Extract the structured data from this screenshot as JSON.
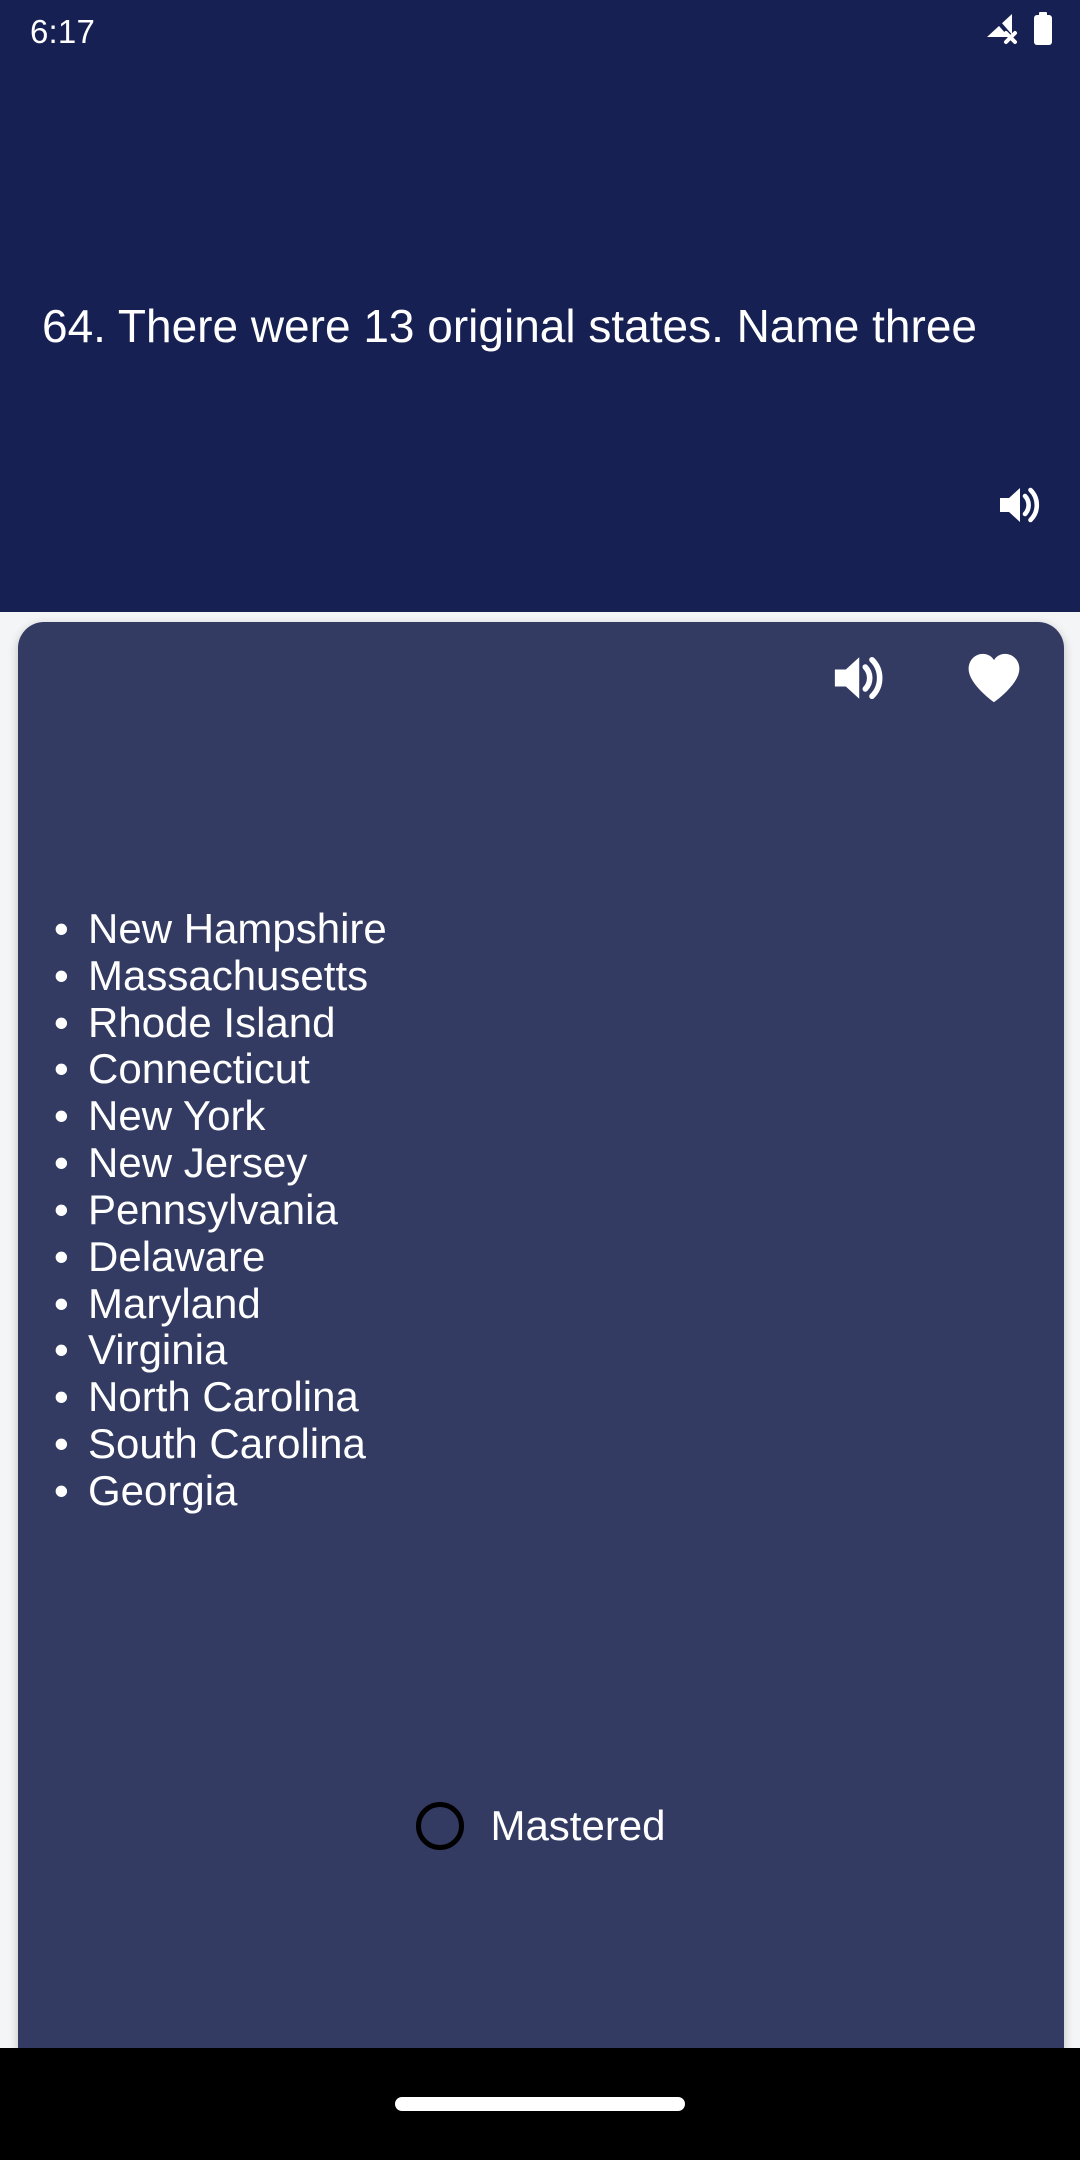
{
  "status_bar": {
    "time": "6:17",
    "icons": [
      {
        "name": "signal-no-service-icon",
        "glyph": "signal-x"
      },
      {
        "name": "battery-full-icon",
        "glyph": "battery"
      }
    ]
  },
  "question_card": {
    "number_and_text": "64. There were 13 original states. Name three",
    "speaker_button": {
      "name": "speak-question-button",
      "icon": "volume-up-icon"
    }
  },
  "answer_card": {
    "toolbar": [
      {
        "name": "speak-answer-button",
        "icon": "volume-up-icon"
      },
      {
        "name": "favorite-button",
        "icon": "heart-filled-icon"
      }
    ],
    "bullet": "•",
    "items": [
      "New Hampshire",
      "Massachusetts",
      "Rhode Island",
      "Connecticut",
      "New York",
      "New Jersey",
      "Pennsylvania",
      "Delaware",
      "Maryland",
      "Virginia",
      "North Carolina",
      "South Carolina",
      "Georgia"
    ],
    "mastered": {
      "label": "Mastered",
      "checked": false
    }
  },
  "nav_bar": {
    "home_indicator": "home-indicator"
  },
  "colors": {
    "header_background": "#172052",
    "card_background": "#333b63",
    "page_background": "#f4f5f7",
    "text": "#ffffff",
    "nav_background": "#000000",
    "radio_border": "#000000"
  }
}
